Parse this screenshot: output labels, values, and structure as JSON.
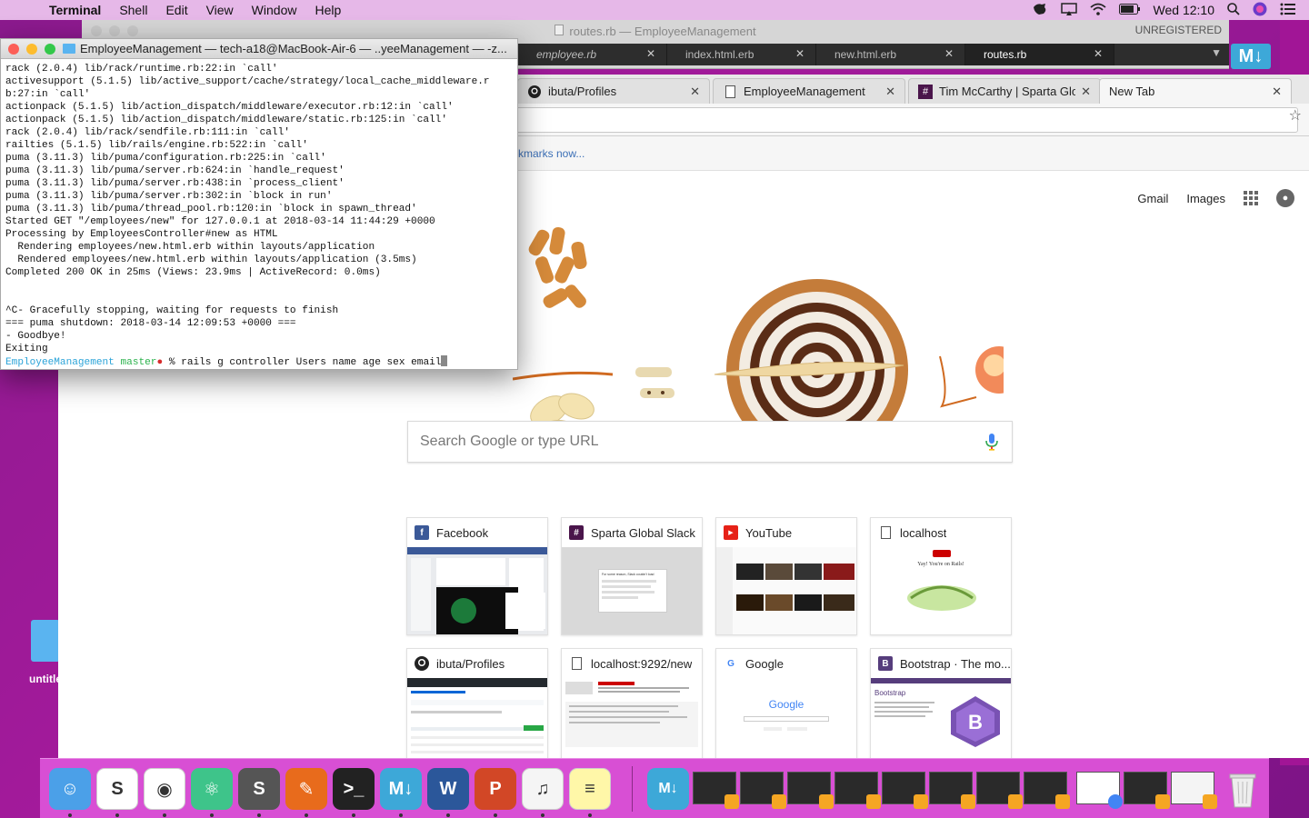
{
  "menubar": {
    "app": "Terminal",
    "menus": [
      "Shell",
      "Edit",
      "View",
      "Window",
      "Help"
    ],
    "clock": "Wed 12:10"
  },
  "desktop": {
    "folder_label": "untitle"
  },
  "sublime": {
    "title": "routes.rb — EmployeeManagement",
    "unregistered": "UNREGISTERED",
    "tabs": [
      "employee.rb",
      "index.html.erb",
      "new.html.erb",
      "routes.rb"
    ]
  },
  "chrome": {
    "tabs": [
      {
        "title": "ibuta/Profiles"
      },
      {
        "title": "EmployeeManagement"
      },
      {
        "title": "Tim McCarthy | Sparta Glob"
      },
      {
        "title": "New Tab"
      }
    ],
    "bookmarks_hint": "kmarks now...",
    "ntp": {
      "gmail": "Gmail",
      "images": "Images",
      "search_placeholder": "Search Google or type URL",
      "tiles": [
        {
          "name": "Facebook",
          "fav": "f",
          "color": "#3b5998"
        },
        {
          "name": "Sparta Global Slack",
          "fav": "#",
          "color": "#4a154b"
        },
        {
          "name": "YouTube",
          "fav": "▶",
          "color": "#e62117"
        },
        {
          "name": "localhost",
          "fav": "",
          "color": "#ffffff"
        },
        {
          "name": "ibuta/Profiles",
          "fav": "",
          "color": "#24292e"
        },
        {
          "name": "localhost:9292/new",
          "fav": "",
          "color": "#ffffff"
        },
        {
          "name": "Google",
          "fav": "G",
          "color": "#ffffff"
        },
        {
          "name": "Bootstrap · The mo...",
          "fav": "B",
          "color": "#563d7c"
        }
      ],
      "slack_thumb_title": "For some reason, Slack couldn't load",
      "rails_thumb_text": "Yay! You're on Rails!",
      "google_thumb_logo": "Google",
      "bootstrap_thumb_title": "Bootstrap"
    }
  },
  "terminal": {
    "title": "EmployeeManagement — tech-a18@MacBook-Air-6 — ..yeeManagement — -z...",
    "lines": [
      "rack (2.0.4) lib/rack/runtime.rb:22:in `call'",
      "activesupport (5.1.5) lib/active_support/cache/strategy/local_cache_middleware.r",
      "b:27:in `call'",
      "actionpack (5.1.5) lib/action_dispatch/middleware/executor.rb:12:in `call'",
      "actionpack (5.1.5) lib/action_dispatch/middleware/static.rb:125:in `call'",
      "rack (2.0.4) lib/rack/sendfile.rb:111:in `call'",
      "railties (5.1.5) lib/rails/engine.rb:522:in `call'",
      "puma (3.11.3) lib/puma/configuration.rb:225:in `call'",
      "puma (3.11.3) lib/puma/server.rb:624:in `handle_request'",
      "puma (3.11.3) lib/puma/server.rb:438:in `process_client'",
      "puma (3.11.3) lib/puma/server.rb:302:in `block in run'",
      "puma (3.11.3) lib/puma/thread_pool.rb:120:in `block in spawn_thread'",
      "Started GET \"/employees/new\" for 127.0.0.1 at 2018-03-14 11:44:29 +0000",
      "Processing by EmployeesController#new as HTML",
      "  Rendering employees/new.html.erb within layouts/application",
      "  Rendered employees/new.html.erb within layouts/application (3.5ms)",
      "Completed 200 OK in 25ms (Views: 23.9ms | ActiveRecord: 0.0ms)",
      "",
      "",
      "^C- Gracefully stopping, waiting for requests to finish",
      "=== puma shutdown: 2018-03-14 12:09:53 +0000 ===",
      "- Goodbye!",
      "Exiting"
    ],
    "prompt_dir": "EmployeeManagement",
    "prompt_branch": "master",
    "prompt_dot": "●",
    "prompt_symbol": "%",
    "command": "rails g controller Users name age sex email"
  },
  "dock": {
    "apps": [
      {
        "name": "finder-icon",
        "color": "#4ba0e8",
        "glyph": "☺"
      },
      {
        "name": "slack-icon",
        "color": "#ffffff",
        "glyph": "S"
      },
      {
        "name": "chrome-icon",
        "color": "#ffffff",
        "glyph": "◉"
      },
      {
        "name": "atom-icon",
        "color": "#3ec48a",
        "glyph": "⚛"
      },
      {
        "name": "sublime-icon",
        "color": "#555555",
        "glyph": "S"
      },
      {
        "name": "script-editor-icon",
        "color": "#e86b1c",
        "glyph": "✎"
      },
      {
        "name": "terminal-icon",
        "color": "#222222",
        "glyph": ">_"
      },
      {
        "name": "markdown-icon",
        "color": "#3da8d8",
        "glyph": "M↓"
      },
      {
        "name": "word-icon",
        "color": "#2b579a",
        "glyph": "W"
      },
      {
        "name": "powerpoint-icon",
        "color": "#d24726",
        "glyph": "P"
      },
      {
        "name": "itunes-icon",
        "color": "#f5f5f5",
        "glyph": "♫"
      },
      {
        "name": "notes-icon",
        "color": "#fff7a8",
        "glyph": "≡"
      }
    ]
  }
}
